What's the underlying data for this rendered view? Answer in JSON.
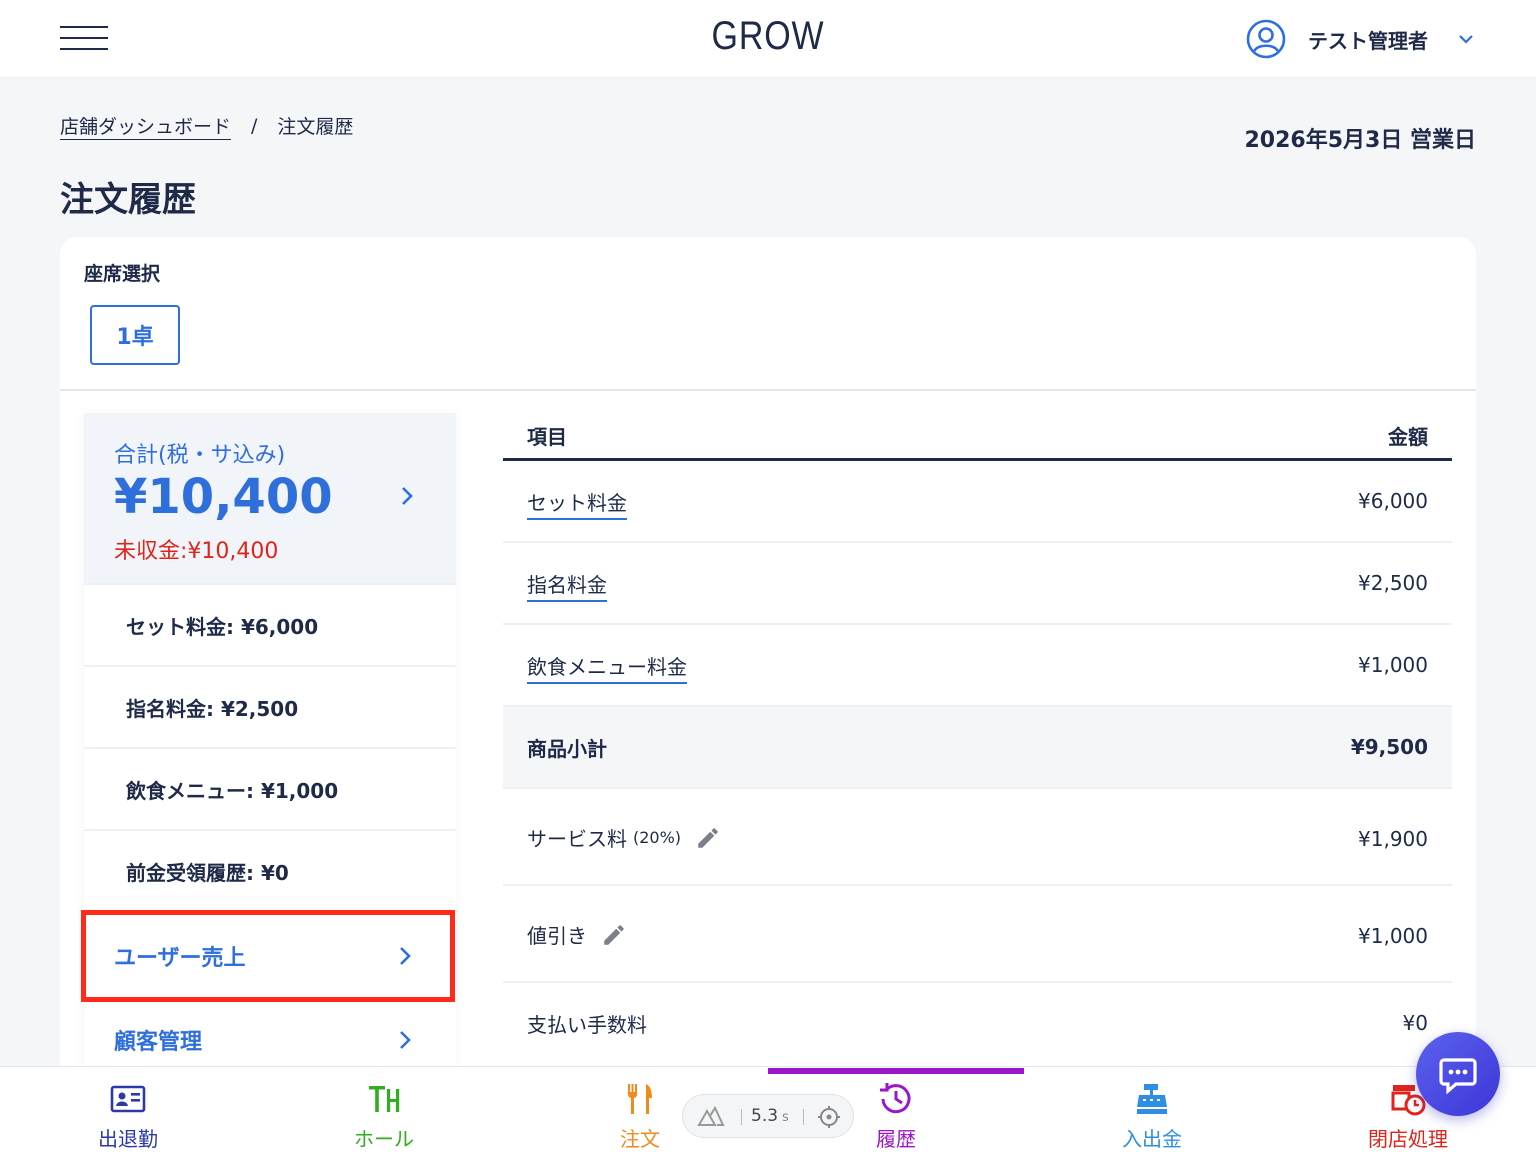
{
  "header": {
    "logo": "GROW",
    "user_name": "テスト管理者"
  },
  "breadcrumb": {
    "parent": "店舗ダッシュボード",
    "separator": "/",
    "current": "注文履歴"
  },
  "business_date": "2026年5月3日 営業日",
  "page_title": "注文履歴",
  "seat": {
    "label": "座席選択",
    "selected": "1卓"
  },
  "summary": {
    "total_label": "合計(税・サ込み)",
    "total_amount": "¥10,400",
    "unpaid": "未収金:¥10,400",
    "rows": [
      "セット料金: ¥6,000",
      "指名料金: ¥2,500",
      "飲食メニュー: ¥1,000",
      "前金受領履歴: ¥0"
    ],
    "links": [
      "ユーザー売上",
      "顧客管理"
    ]
  },
  "table": {
    "col_item": "項目",
    "col_amount": "金額",
    "rows": [
      {
        "name": "セット料金",
        "amount": "¥6,000"
      },
      {
        "name": "指名料金",
        "amount": "¥2,500"
      },
      {
        "name": "飲食メニュー料金",
        "amount": "¥1,000"
      },
      {
        "name": "商品小計",
        "amount": "¥9,500"
      },
      {
        "name": "サービス料",
        "note": "(20%)",
        "amount": "¥1,900"
      },
      {
        "name": "値引き",
        "amount": "¥1,000"
      },
      {
        "name": "支払い手数料",
        "amount": "¥0"
      }
    ]
  },
  "bottom_nav": [
    {
      "label": "出退勤",
      "color": "#2b3aa8"
    },
    {
      "label": "ホール",
      "color": "#2fae1f"
    },
    {
      "label": "注文",
      "color": "#f28a1c"
    },
    {
      "label": "履歴",
      "color": "#9a16c8"
    },
    {
      "label": "入出金",
      "color": "#2f8fe0"
    },
    {
      "label": "閉店処理",
      "color": "#e0241b"
    }
  ],
  "speed_indicator": {
    "value": "5.3",
    "unit": "s"
  },
  "colors": {
    "primary": "#2f6fdc",
    "navy": "#1e2a48",
    "alert": "#e0241b",
    "highlight": "#ff2a1a"
  }
}
